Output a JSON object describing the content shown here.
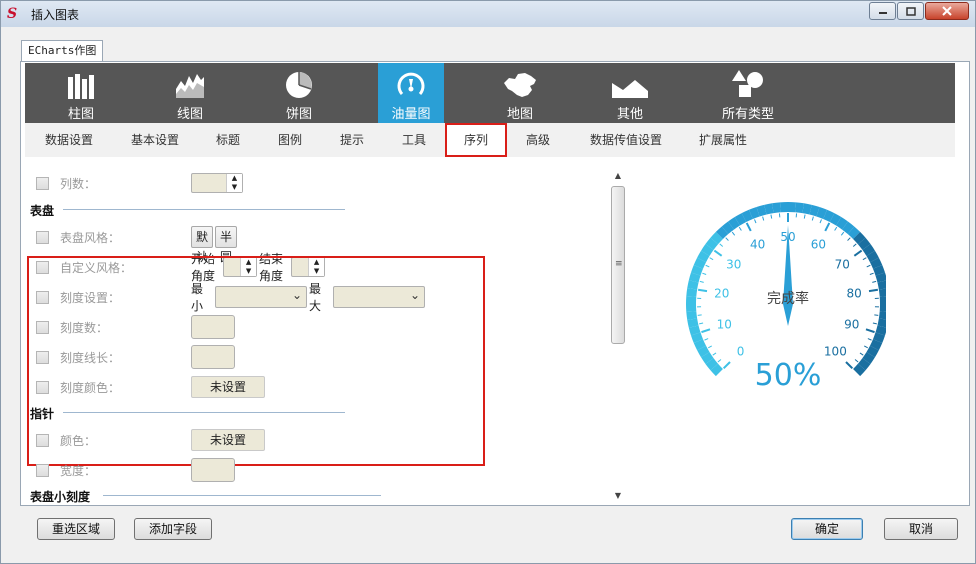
{
  "window": {
    "title": "插入图表",
    "logo": "S"
  },
  "editor_tab": "ECharts作图",
  "chart_types": [
    {
      "label": "柱图",
      "icon": "bar-chart-icon"
    },
    {
      "label": "线图",
      "icon": "line-chart-icon"
    },
    {
      "label": "饼图",
      "icon": "pie-chart-icon"
    },
    {
      "label": "油量图",
      "icon": "gauge-icon",
      "active": true
    },
    {
      "label": "地图",
      "icon": "china-map-icon"
    },
    {
      "label": "其他",
      "icon": "mountain-icon"
    },
    {
      "label": "所有类型",
      "icon": "shapes-icon"
    }
  ],
  "sub_tabs": [
    "数据设置",
    "基本设置",
    "标题",
    "图例",
    "提示",
    "工具",
    "序列",
    "高级",
    "数据传值设置",
    "扩展属性"
  ],
  "active_sub_tab": "序列",
  "form": {
    "columns_label": "列数：",
    "dial_section": "表盘",
    "dial_style_label": "表盘风格：",
    "dial_style_default": "默认",
    "dial_style_half": "半圆",
    "custom_style_label": "自定义风格：",
    "start_angle": "开始角度",
    "end_angle": "结束角度",
    "scale_setting_label": "刻度设置：",
    "min": "最小",
    "max": "最大",
    "scale_count_label": "刻度数：",
    "scale_line_len_label": "刻度线长：",
    "scale_color_label": "刻度颜色：",
    "not_set": "未设置",
    "pointer_section": "指针",
    "color_label": "颜色：",
    "width_label": "宽度：",
    "small_scale_section": "表盘小刻度"
  },
  "gauge": {
    "title": "完成率",
    "value": 50,
    "value_text": "50%",
    "ticks": [
      "0",
      "10",
      "20",
      "30",
      "40",
      "50",
      "60",
      "70",
      "80",
      "90",
      "100"
    ],
    "color_light": "#3ec1e6",
    "color_mid": "#2a9fd6",
    "color_dark": "#1a6fa0"
  },
  "buttons": {
    "reselect": "重选区域",
    "add_field": "添加字段",
    "ok": "确定",
    "cancel": "取消"
  },
  "colors": {
    "accent": "#2a9fd6",
    "highlight": "#d91e18",
    "toolbar": "#565656"
  }
}
